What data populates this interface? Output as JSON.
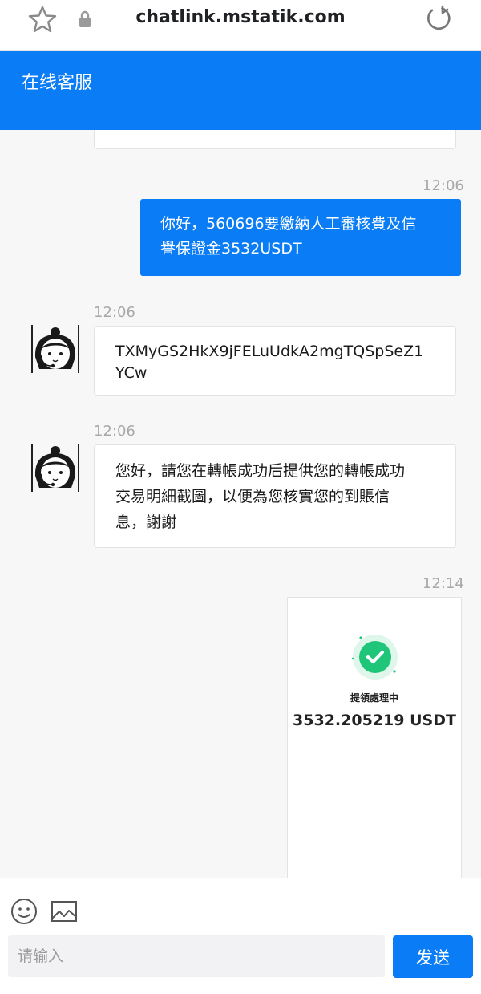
{
  "browser": {
    "url": "chatlink.mstatik.com",
    "icons": [
      "star-icon",
      "lock-icon",
      "reload-icon"
    ]
  },
  "header": {
    "title": "在线客服"
  },
  "messages": [
    {
      "direction": "incoming",
      "time": "",
      "text": ""
    },
    {
      "direction": "outgoing",
      "time": "12:06",
      "lines": [
        "你好，560696要繳納人工審核費及信",
        "譽保證金3532USDT"
      ]
    },
    {
      "direction": "incoming",
      "time": "12:06",
      "lines": [
        "TXMyGS2HkX9jFELuUdkA2mgTQSpSeZ1",
        "YCw"
      ]
    },
    {
      "direction": "incoming",
      "time": "12:06",
      "lines": [
        "您好，請您在轉帳成功后提供您的轉帳成功",
        "交易明細截圖，以便為您核實您的到賬信",
        "息，謝謝"
      ]
    },
    {
      "direction": "outgoing",
      "time": "12:14",
      "image": {
        "status": "提領處理中",
        "amount": "3532.205219 USDT"
      }
    }
  ],
  "input": {
    "placeholder": "请输入",
    "value": "",
    "send_label": "发送",
    "icons": [
      "emoji-icon",
      "image-icon"
    ]
  },
  "colors": {
    "accent": "#0a7cf5",
    "chat_bg": "#f7f7f7",
    "success": "#1fc67a"
  }
}
